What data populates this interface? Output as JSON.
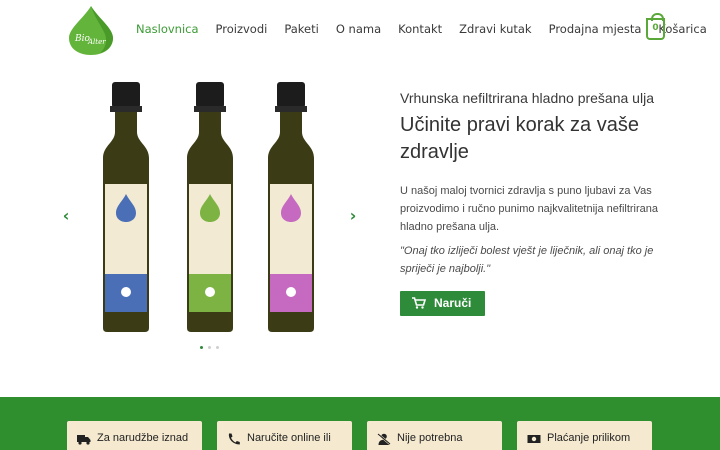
{
  "brand": {
    "logo_text": "Bio Alternative",
    "accent": "#2e8b3a",
    "nav_active": "#3c9b35",
    "band_color": "#2f8f2f"
  },
  "nav": {
    "items": [
      {
        "label": "Naslovnica",
        "active": true
      },
      {
        "label": "Proizvodi"
      },
      {
        "label": "Paketi"
      },
      {
        "label": "O nama"
      },
      {
        "label": "Kontakt"
      },
      {
        "label": "Zdravi kutak"
      },
      {
        "label": "Prodajna mjesta"
      },
      {
        "label": "Košarica"
      }
    ],
    "cart_count": "0"
  },
  "slider": {
    "prev_icon": "chevron-left-icon",
    "next_icon": "chevron-right-icon",
    "bottles": [
      {
        "label_color": "#4b6fb7",
        "drop_color": "#4b6fb7"
      },
      {
        "label_color": "#7cb342",
        "drop_color": "#7cb342"
      },
      {
        "label_color": "#c56ac0",
        "drop_color": "#c56ac0"
      }
    ],
    "dots": 3,
    "active_dot": 0
  },
  "hero": {
    "kicker": "Vrhunska nefiltrirana hladno prešana ulja",
    "headline": "Učinite pravi korak za vaše zdravlje",
    "description": "U našoj maloj tvornici zdravlja s puno ljubavi za Vas proizvodimo i ručno punimo najkvalitetnija nefiltrirana hladno prešana ulja.",
    "quote": "\"Onaj tko izliječi bolest vješt je liječnik, ali onaj tko je spriječi je najbolji.\"",
    "order_label": "Naruči",
    "order_icon": "cart-icon"
  },
  "features": [
    {
      "text": "Za narudžbe iznad",
      "icon": "truck-icon"
    },
    {
      "text": "Naručite online ili",
      "icon": "phone-icon"
    },
    {
      "text": "Nije potrebna",
      "icon": "user-slash-icon"
    },
    {
      "text": "Plaćanje prilikom",
      "icon": "money-icon"
    }
  ]
}
